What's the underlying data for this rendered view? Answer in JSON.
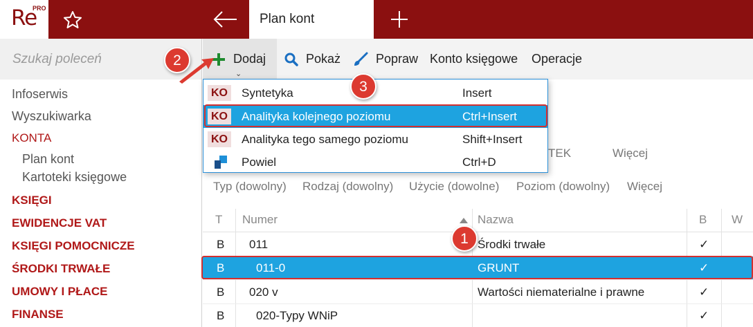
{
  "app": {
    "logo_text": "Re",
    "logo_badge": "PRO",
    "tab_title": "Plan kont"
  },
  "sidebar": {
    "search_placeholder": "Szukaj poleceń",
    "items": [
      {
        "label": "Infoserwis"
      },
      {
        "label": "Wyszukiwarka"
      },
      {
        "label": "KONTA"
      },
      {
        "label": "Plan kont"
      },
      {
        "label": "Kartoteki księgowe"
      },
      {
        "label": "KSIĘGI"
      },
      {
        "label": "EWIDENCJE VAT"
      },
      {
        "label": "KSIĘGI POMOCNICZE"
      },
      {
        "label": "ŚRODKI TRWAŁE"
      },
      {
        "label": "UMOWY I PŁACE"
      },
      {
        "label": "FINANSE"
      }
    ]
  },
  "toolbar": {
    "add_label": "Dodaj",
    "show_label": "Pokaż",
    "edit_label": "Popraw",
    "account_label": "Konto księgowe",
    "operations_label": "Operacje"
  },
  "menu": {
    "items": [
      {
        "badge": "KO",
        "label": "Syntetyka",
        "shortcut": "Insert"
      },
      {
        "badge": "KO",
        "label": "Analityka kolejnego poziomu",
        "shortcut": "Ctrl+Insert"
      },
      {
        "badge": "KO",
        "label": "Analityka tego samego poziomu",
        "shortcut": "Shift+Insert"
      },
      {
        "badge": "",
        "label": "Powiel",
        "shortcut": "Ctrl+D"
      }
    ]
  },
  "tabs_partial": {
    "hidden_tab": "TEK",
    "more": "Więcej"
  },
  "filters": {
    "type": "Typ (dowolny)",
    "kind": "Rodzaj (dowolny)",
    "usage": "Użycie (dowolne)",
    "level": "Poziom (dowolny)",
    "more": "Więcej"
  },
  "table": {
    "headers": {
      "t": "T",
      "numer": "Numer",
      "nazwa": "Nazwa",
      "b": "B",
      "w": "W"
    },
    "rows": [
      {
        "t": "B",
        "numer": "011",
        "nazwa": "Środki trwałe",
        "b": "✓"
      },
      {
        "t": "B",
        "numer": "011-0",
        "nazwa": "GRUNT",
        "b": "✓"
      },
      {
        "t": "B",
        "numer": "020 v",
        "nazwa": "Wartości niematerialne i prawne",
        "b": "✓"
      },
      {
        "t": "B",
        "numer": "020-Typy WNiP",
        "nazwa": "",
        "b": "✓"
      }
    ]
  },
  "steps": {
    "one": "1",
    "two": "2",
    "three": "3"
  },
  "colors": {
    "brand": "#8b1010",
    "selection": "#1ea3e0",
    "callout": "#dc3a30"
  }
}
